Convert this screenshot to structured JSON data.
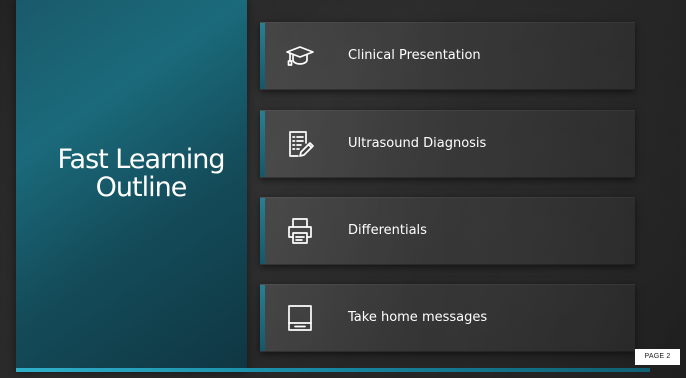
{
  "slide": {
    "title": "Fast Learning\nOutline",
    "page_label": "PAGE 2"
  },
  "items": [
    {
      "label": "Clinical Presentation",
      "icon": "graduation-cap-icon"
    },
    {
      "label": "Ultrasound Diagnosis",
      "icon": "checklist-pencil-icon"
    },
    {
      "label": "Differentials",
      "icon": "printer-icon"
    },
    {
      "label": "Take home messages",
      "icon": "tray-icon"
    }
  ],
  "colors": {
    "title_panel": "#1a6a7b",
    "accent_bar": "#2fb0ca",
    "tile_marker": "#2a7f92",
    "text": "#ffffff"
  }
}
